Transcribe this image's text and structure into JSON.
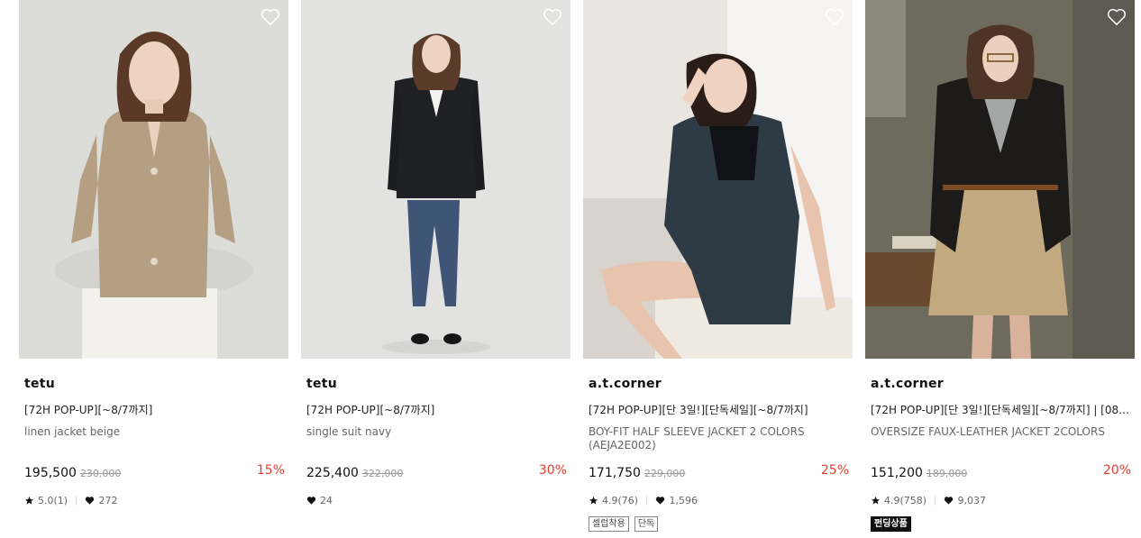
{
  "products": [
    {
      "brand": "tetu",
      "tag_line": "[72H POP-UP][~8/7까지]",
      "name": "linen jacket beige",
      "price": "195,500",
      "original_price": "230,000",
      "discount": "15%",
      "rating": "5.0(1)",
      "likes": "272",
      "badges": []
    },
    {
      "brand": "tetu",
      "tag_line": "[72H POP-UP][~8/7까지]",
      "name": "single suit navy",
      "price": "225,400",
      "original_price": "322,000",
      "discount": "30%",
      "rating": "",
      "likes": "24",
      "badges": []
    },
    {
      "brand": "a.t.corner",
      "tag_line": "[72H POP-UP][단 3일!][단독세일][~8/7까지]",
      "name": "BOY-FIT HALF SLEEVE JACKET 2 COLORS (AEJA2E002)",
      "price": "171,750",
      "original_price": "229,000",
      "discount": "25%",
      "rating": "4.9(76)",
      "likes": "1,596",
      "badges": [
        "셀럽착용",
        "단독"
      ]
    },
    {
      "brand": "a.t.corner",
      "tag_line": "[72H POP-UP][단 3일!][단독세일][~8/7까지] | [08/22…",
      "name": "OVERSIZE FAUX-LEATHER JACKET 2COLORS",
      "price": "151,200",
      "original_price": "189,000",
      "discount": "20%",
      "rating": "4.9(758)",
      "likes": "9,037",
      "badges": [
        "펀딩상품"
      ]
    }
  ],
  "colors": {
    "discount": "#e83c2e",
    "text": "#111111",
    "muted": "#666666"
  },
  "icons": {
    "wishlist": "heart-outline-icon",
    "rating": "star-icon",
    "likes": "heart-filled-icon"
  }
}
